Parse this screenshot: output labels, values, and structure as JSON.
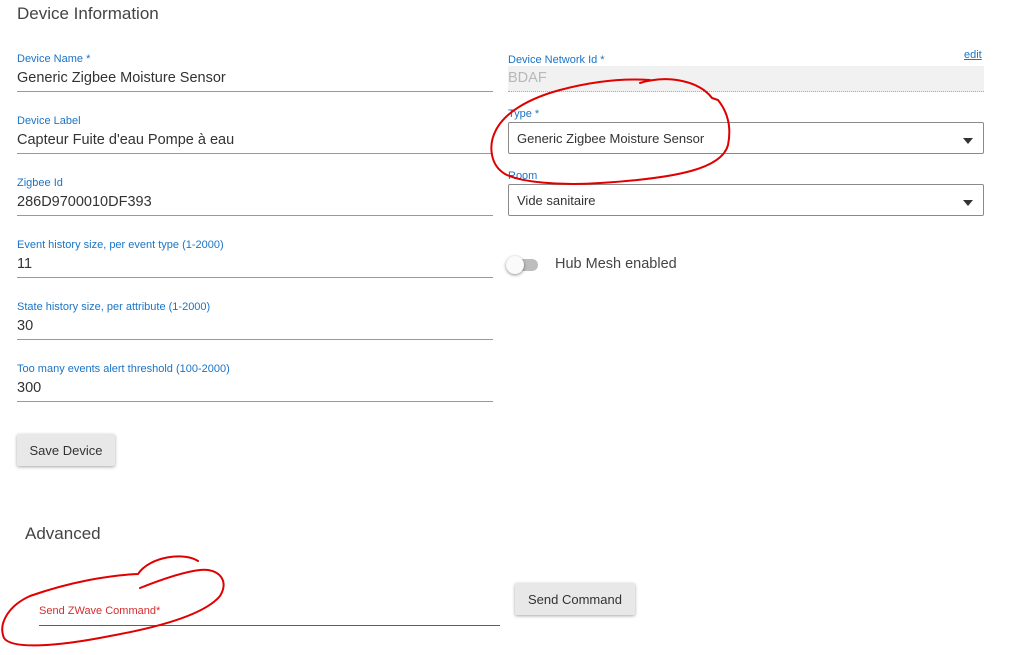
{
  "device_info": {
    "title": "Device Information",
    "fields": [
      {
        "label": "Device Name *",
        "value": "Generic Zigbee Moisture Sensor"
      },
      {
        "label": "Device Label",
        "value": "Capteur Fuite d'eau Pompe à eau"
      },
      {
        "label": "Zigbee Id",
        "value": "286D9700010DF393"
      },
      {
        "label": "Event history size, per event type (1-2000)",
        "value": "11"
      },
      {
        "label": "State history size, per attribute (1-2000)",
        "value": "30"
      },
      {
        "label": "Too many events alert threshold (100-2000)",
        "value": "300"
      }
    ],
    "network_id": {
      "label": "Device Network Id *",
      "value": "BDAF",
      "edit_label": "edit"
    },
    "type": {
      "label": "Type *",
      "value": "Generic Zigbee Moisture Sensor"
    },
    "room": {
      "label": "Room",
      "value": "Vide sanitaire"
    },
    "hub_mesh": {
      "label": "Hub Mesh enabled",
      "enabled": false
    },
    "save_button": "Save Device"
  },
  "advanced": {
    "title": "Advanced",
    "zwave_command": {
      "label": "Send ZWave Command*",
      "value": ""
    },
    "send_button": "Send Command"
  },
  "colors": {
    "label_blue": "#1b74c5",
    "error_red": "#d32f2f",
    "annotation_red": "#e00000"
  },
  "icons": [
    "dropdown-caret-icon"
  ]
}
